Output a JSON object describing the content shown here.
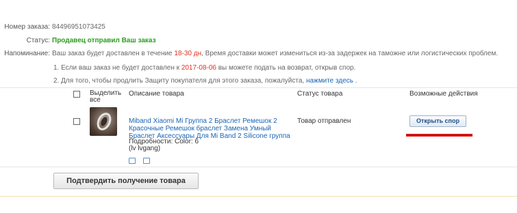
{
  "order": {
    "number_label": "Номер заказа:",
    "number_value": "84496951073425",
    "status_label": "Статус:",
    "status_value": "Продавец отправил Ваш заказ",
    "reminder_label": "Напоминание:",
    "reminder_part1": "Ваш заказ будет доставлен в течение ",
    "reminder_days": "18-30 дн",
    "reminder_part2": ", Время доставки может измениться из-за задержек на таможне или логистических проблем.",
    "note1_part1": "1. Если ваш заказ не будет доставлен к ",
    "note1_date": "2017-08-06",
    "note1_part2": " вы можете подать на возврат, открыв спор.",
    "note2_part1": "2. Для того, чтобы продлить Защиту покупателя для этого заказа, пожалуйста, ",
    "note2_link": "нажмите здесь",
    "note2_part2": " ."
  },
  "table": {
    "headers": {
      "select_line1": "Выделить",
      "select_line2": "все",
      "description": "Описание товара",
      "status": "Статус товара",
      "actions": "Возможные действия"
    },
    "item": {
      "title_line1": "Miband Xiaomi Mi Группа 2 Браслет Ремешок 2",
      "title_line2": "Красочные Ремешок браслет Замена Умный",
      "title_line3": "Браслет Аксессуары Для Mi Band 2 Silicone группа",
      "details_line1": "Подробности: Color: 6",
      "details_line2": "(lv lvgang)",
      "status": "Товар отправлен",
      "dispute_button": "Открыть спор"
    }
  },
  "confirm_button": "Подтвердить получение товара",
  "colors": {
    "status_green": "#2a9d1e",
    "highlight_red": "#e0301e",
    "link_blue": "#1a64b4",
    "annotation_red": "#d21414"
  }
}
